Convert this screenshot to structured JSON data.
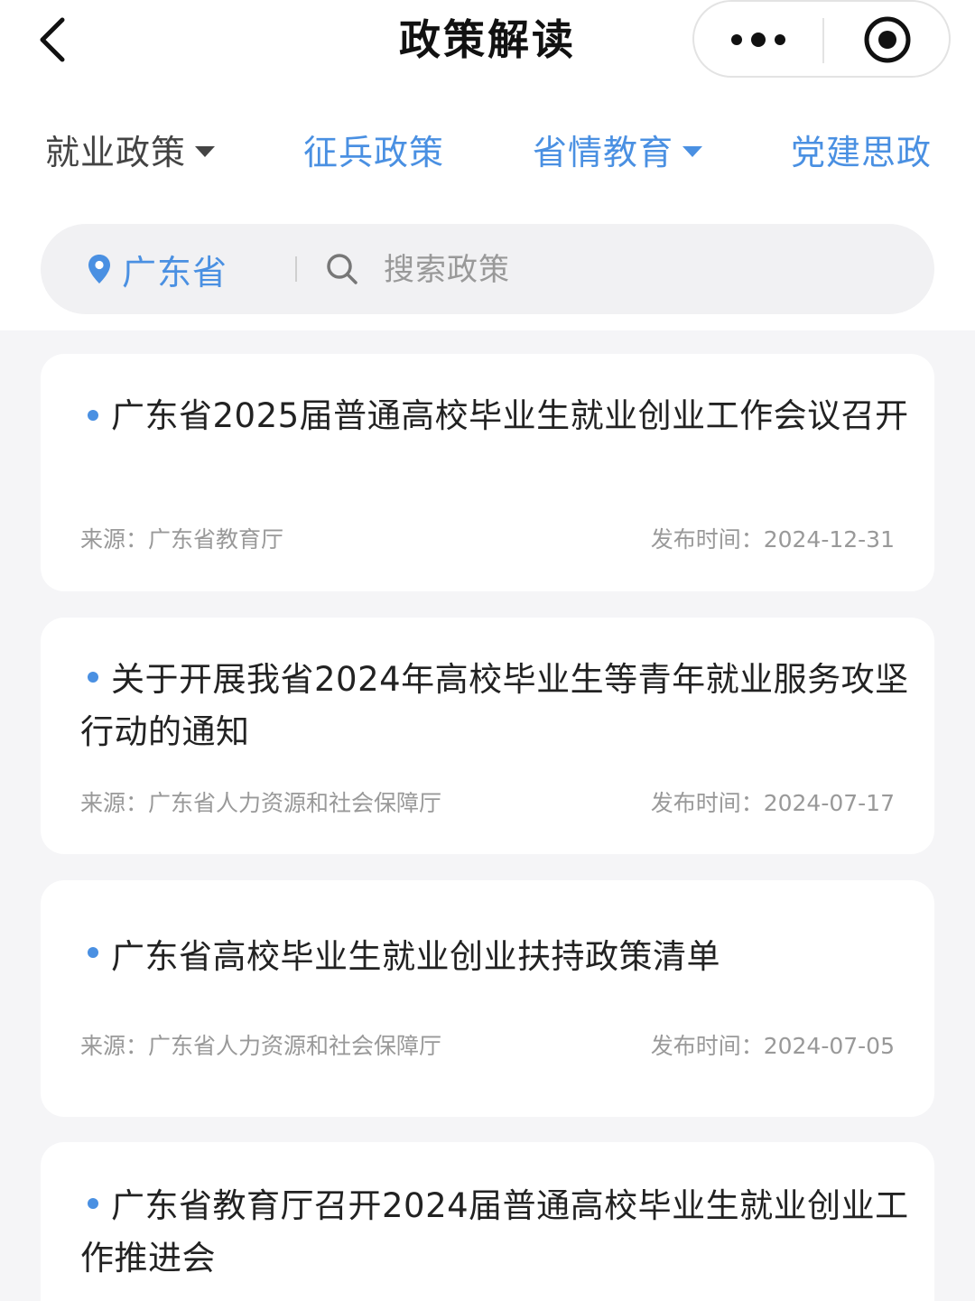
{
  "header": {
    "title": "政策解读",
    "back_icon": "chevron-left-icon",
    "more_icon": "more-dots-icon",
    "close_icon": "target-circle-icon"
  },
  "tabs": [
    {
      "label": "就业政策",
      "active": true,
      "has_dropdown": true
    },
    {
      "label": "征兵政策",
      "active": false,
      "has_dropdown": false
    },
    {
      "label": "省情教育",
      "active": false,
      "has_dropdown": true
    },
    {
      "label": "党建思政",
      "active": false,
      "has_dropdown": false
    }
  ],
  "search": {
    "location": "广东省",
    "placeholder": "搜索政策"
  },
  "policies": [
    {
      "title": "广东省2025届普通高校毕业生就业创业工作会议召开",
      "source": "来源：广东省教育厅",
      "date": "发布时间：2024-12-31"
    },
    {
      "title": "关于开展我省2024年高校毕业生等青年就业服务攻坚行动的通知",
      "source": "来源：广东省人力资源和社会保障厅",
      "date": "发布时间：2024-07-17"
    },
    {
      "title": "广东省高校毕业生就业创业扶持政策清单",
      "source": "来源：广东省人力资源和社会保障厅",
      "date": "发布时间：2024-07-05"
    },
    {
      "title": "广东省教育厅召开2024届普通高校毕业生就业创业工作推进会",
      "source": "",
      "date": ""
    }
  ],
  "colors": {
    "accent": "#4a90e2",
    "background": "#f5f5f7",
    "card": "#ffffff"
  }
}
